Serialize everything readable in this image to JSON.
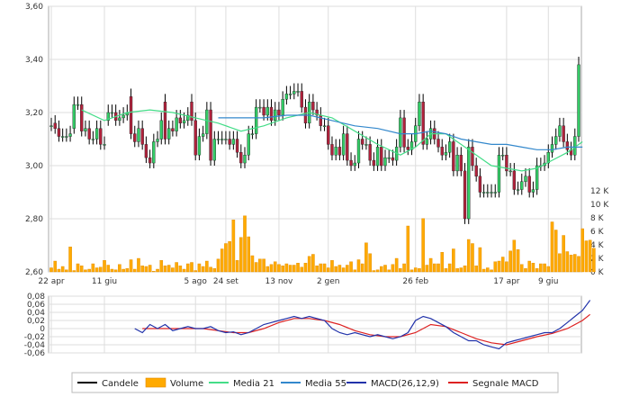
{
  "chart_data": {
    "type": "candlestick",
    "colors": {
      "up": "#33cc66",
      "down": "#b0213b",
      "wick": "#000000",
      "volume": "#ffaa00",
      "ma21": "#44dd88",
      "ma55": "#3388cc",
      "macd": "#2233aa",
      "signal": "#dd2222",
      "grid": "#dddddd"
    },
    "price_axis": {
      "ylim": [
        2.6,
        3.6
      ],
      "ticks": [
        {
          "v": 2.6,
          "label": "2,60"
        },
        {
          "v": 2.8,
          "label": "2,80"
        },
        {
          "v": 3.0,
          "label": "3,00"
        },
        {
          "v": 3.2,
          "label": "3,20"
        },
        {
          "v": 3.4,
          "label": "3,40"
        },
        {
          "v": 3.6,
          "label": "3,60"
        }
      ]
    },
    "volume_axis": {
      "ylim": [
        0,
        12000
      ],
      "ticks": [
        {
          "v": 0,
          "label": "0 K"
        },
        {
          "v": 2000,
          "label": "2 K"
        },
        {
          "v": 4000,
          "label": "4 K"
        },
        {
          "v": 6000,
          "label": "6 K"
        },
        {
          "v": 8000,
          "label": "8 K"
        },
        {
          "v": 10000,
          "label": "10 K"
        },
        {
          "v": 12000,
          "label": "12 K"
        }
      ]
    },
    "macd_axis": {
      "ylim": [
        -0.06,
        0.08
      ],
      "ticks": [
        {
          "v": -0.06,
          "label": "-0,06"
        },
        {
          "v": -0.04,
          "label": "-0,04"
        },
        {
          "v": -0.02,
          "label": "-0,02"
        },
        {
          "v": 0,
          "label": "0"
        },
        {
          "v": 0.02,
          "label": "0,02"
        },
        {
          "v": 0.04,
          "label": "0,04"
        },
        {
          "v": 0.06,
          "label": "0,06"
        },
        {
          "v": 0.08,
          "label": "0,08"
        }
      ]
    },
    "x_ticks": [
      {
        "i": 0,
        "label": "22 apr"
      },
      {
        "i": 14,
        "label": "11 giu"
      },
      {
        "i": 38,
        "label": "5 ago"
      },
      {
        "i": 46,
        "label": "24 set"
      },
      {
        "i": 60,
        "label": "13 nov"
      },
      {
        "i": 73,
        "label": "2 gen"
      },
      {
        "i": 96,
        "label": "26 feb"
      },
      {
        "i": 120,
        "label": "17 apr"
      },
      {
        "i": 131,
        "label": "9 giu"
      }
    ],
    "candles": {
      "close": [
        3.15,
        3.14,
        3.11,
        3.11,
        3.11,
        3.12,
        3.23,
        3.23,
        3.13,
        3.14,
        3.1,
        3.1,
        3.14,
        3.08,
        3.08,
        3.2,
        3.2,
        3.17,
        3.18,
        3.19,
        3.2,
        3.12,
        3.09,
        3.14,
        3.08,
        3.03,
        3.01,
        3.09,
        3.1,
        3.17,
        3.1,
        3.14,
        3.13,
        3.18,
        3.16,
        3.17,
        3.19,
        3.17,
        3.04,
        3.11,
        3.12,
        3.21,
        3.02,
        3.1,
        3.1,
        3.1,
        3.1,
        3.08,
        3.1,
        3.05,
        3.01,
        3.04,
        3.12,
        3.12,
        3.22,
        3.22,
        3.19,
        3.22,
        3.17,
        3.21,
        3.19,
        3.25,
        3.27,
        3.27,
        3.28,
        3.28,
        3.22,
        3.16,
        3.24,
        3.21,
        3.19,
        3.15,
        3.15,
        3.08,
        3.04,
        3.07,
        3.04,
        3.12,
        3.02,
        3.0,
        3.01,
        3.1,
        3.08,
        3.08,
        3.02,
        3.0,
        3.07,
        3.0,
        3.03,
        3.03,
        3.02,
        3.07,
        3.18,
        3.07,
        3.06,
        3.09,
        3.15,
        3.24,
        3.08,
        3.1,
        3.14,
        3.1,
        3.07,
        3.04,
        3.05,
        3.09,
        2.98,
        3.04,
        2.98,
        2.8,
        3.07,
        3.0,
        2.96,
        2.9,
        2.9,
        2.9,
        2.9,
        2.9,
        3.04,
        3.04,
        2.98,
        2.98,
        2.91,
        2.91,
        2.94,
        2.96,
        2.9,
        2.91,
        3.0,
        3.0,
        3.01,
        3.05,
        3.08,
        3.11,
        3.15,
        3.09,
        3.06,
        3.04,
        3.11,
        3.38
      ],
      "open": [
        3.15,
        3.16,
        3.14,
        3.11,
        3.11,
        3.11,
        3.14,
        3.23,
        3.23,
        3.13,
        3.14,
        3.1,
        3.1,
        3.14,
        3.08,
        3.17,
        3.2,
        3.2,
        3.17,
        3.18,
        3.19,
        3.26,
        3.12,
        3.09,
        3.14,
        3.08,
        3.03,
        3.01,
        3.09,
        3.1,
        3.24,
        3.1,
        3.14,
        3.13,
        3.18,
        3.16,
        3.17,
        3.24,
        3.17,
        3.04,
        3.11,
        3.12,
        3.21,
        3.02,
        3.1,
        3.1,
        3.1,
        3.1,
        3.08,
        3.1,
        3.05,
        3.01,
        3.04,
        3.12,
        3.12,
        3.22,
        3.22,
        3.19,
        3.22,
        3.17,
        3.21,
        3.19,
        3.25,
        3.27,
        3.27,
        3.28,
        3.28,
        3.22,
        3.16,
        3.24,
        3.21,
        3.19,
        3.15,
        3.15,
        3.08,
        3.04,
        3.07,
        3.04,
        3.12,
        3.02,
        3.0,
        3.01,
        3.1,
        3.08,
        3.08,
        3.02,
        3.0,
        3.07,
        3.0,
        3.03,
        3.03,
        3.02,
        3.07,
        3.18,
        3.07,
        3.06,
        3.09,
        3.15,
        3.24,
        3.08,
        3.1,
        3.14,
        3.1,
        3.07,
        3.04,
        3.05,
        3.09,
        2.98,
        3.04,
        2.98,
        2.8,
        3.07,
        3.0,
        2.96,
        2.9,
        2.9,
        2.9,
        2.9,
        2.9,
        3.04,
        3.04,
        2.98,
        2.98,
        2.91,
        2.91,
        2.94,
        2.96,
        2.9,
        2.91,
        3.0,
        3.0,
        3.01,
        3.05,
        3.08,
        3.11,
        3.15,
        3.09,
        3.06,
        3.04,
        3.11
      ],
      "volume": [
        600,
        1600,
        400,
        800,
        300,
        3700,
        200,
        1200,
        900,
        300,
        400,
        1200,
        600,
        700,
        1700,
        1000,
        400,
        300,
        1100,
        400,
        500,
        1800,
        400,
        2000,
        900,
        800,
        1000,
        100,
        400,
        1700,
        900,
        1000,
        600,
        1400,
        900,
        400,
        1200,
        1400,
        200,
        1200,
        800,
        1600,
        700,
        500,
        1900,
        3400,
        4200,
        4500,
        7700,
        1700,
        5100,
        8300,
        5200,
        2400,
        1400,
        1900,
        1900,
        800,
        1100,
        1500,
        1100,
        900,
        1200,
        1000,
        1000,
        1300,
        700,
        1300,
        2300,
        2600,
        900,
        1200,
        1200,
        600,
        1700,
        800,
        1000,
        600,
        1000,
        1500,
        300,
        1800,
        1200,
        4300,
        2700,
        200,
        300,
        800,
        1000,
        300,
        1100,
        2000,
        500,
        1200,
        6800,
        300,
        600,
        500,
        7900,
        1000,
        2000,
        1200,
        1200,
        2900,
        500,
        1200,
        3400,
        500,
        600,
        900,
        4800,
        4200,
        900,
        3600,
        400,
        600,
        300,
        1500,
        1600,
        2200,
        1500,
        3100,
        4700,
        3300,
        1100,
        500,
        1600,
        1300,
        500,
        1200,
        1200,
        800,
        7400,
        6200,
        2700,
        5400,
        3000,
        2500,
        2600,
        2300,
        6400,
        4600,
        4700,
        3500
      ]
    },
    "ma21": [
      [
        8,
        3.21
      ],
      [
        14,
        3.17
      ],
      [
        20,
        3.2
      ],
      [
        26,
        3.21
      ],
      [
        32,
        3.2
      ],
      [
        38,
        3.18
      ],
      [
        44,
        3.16
      ],
      [
        50,
        3.13
      ],
      [
        56,
        3.15
      ],
      [
        62,
        3.18
      ],
      [
        68,
        3.2
      ],
      [
        74,
        3.18
      ],
      [
        80,
        3.13
      ],
      [
        86,
        3.08
      ],
      [
        92,
        3.04
      ],
      [
        96,
        3.07
      ],
      [
        100,
        3.12
      ],
      [
        104,
        3.12
      ],
      [
        108,
        3.08
      ],
      [
        112,
        3.04
      ],
      [
        116,
        3.0
      ],
      [
        120,
        2.99
      ],
      [
        124,
        2.98
      ],
      [
        128,
        2.99
      ],
      [
        132,
        3.02
      ],
      [
        136,
        3.05
      ],
      [
        140,
        3.09
      ]
    ],
    "ma55": [
      [
        44,
        3.18
      ],
      [
        50,
        3.18
      ],
      [
        56,
        3.18
      ],
      [
        62,
        3.19
      ],
      [
        68,
        3.19
      ],
      [
        74,
        3.17
      ],
      [
        80,
        3.15
      ],
      [
        86,
        3.14
      ],
      [
        92,
        3.12
      ],
      [
        96,
        3.12
      ],
      [
        100,
        3.13
      ],
      [
        104,
        3.12
      ],
      [
        108,
        3.1
      ],
      [
        112,
        3.09
      ],
      [
        116,
        3.08
      ],
      [
        120,
        3.08
      ],
      [
        124,
        3.07
      ],
      [
        128,
        3.06
      ],
      [
        132,
        3.06
      ],
      [
        136,
        3.07
      ],
      [
        140,
        3.07
      ]
    ],
    "macd": [
      [
        22,
        0.0
      ],
      [
        24,
        -0.01
      ],
      [
        26,
        0.01
      ],
      [
        28,
        0.0
      ],
      [
        30,
        0.01
      ],
      [
        32,
        -0.005
      ],
      [
        34,
        0.0
      ],
      [
        36,
        0.005
      ],
      [
        38,
        0.0
      ],
      [
        40,
        0.0
      ],
      [
        42,
        0.005
      ],
      [
        44,
        -0.005
      ],
      [
        46,
        -0.01
      ],
      [
        48,
        -0.008
      ],
      [
        50,
        -0.015
      ],
      [
        52,
        -0.01
      ],
      [
        54,
        0.0
      ],
      [
        56,
        0.01
      ],
      [
        58,
        0.015
      ],
      [
        60,
        0.02
      ],
      [
        62,
        0.025
      ],
      [
        64,
        0.03
      ],
      [
        66,
        0.025
      ],
      [
        68,
        0.03
      ],
      [
        70,
        0.025
      ],
      [
        72,
        0.02
      ],
      [
        74,
        0.0
      ],
      [
        76,
        -0.01
      ],
      [
        78,
        -0.015
      ],
      [
        80,
        -0.01
      ],
      [
        82,
        -0.015
      ],
      [
        84,
        -0.02
      ],
      [
        86,
        -0.015
      ],
      [
        88,
        -0.02
      ],
      [
        90,
        -0.025
      ],
      [
        92,
        -0.02
      ],
      [
        94,
        -0.01
      ],
      [
        96,
        0.02
      ],
      [
        98,
        0.03
      ],
      [
        100,
        0.025
      ],
      [
        102,
        0.015
      ],
      [
        104,
        0.005
      ],
      [
        106,
        -0.01
      ],
      [
        108,
        -0.02
      ],
      [
        110,
        -0.03
      ],
      [
        112,
        -0.03
      ],
      [
        114,
        -0.04
      ],
      [
        116,
        -0.045
      ],
      [
        118,
        -0.05
      ],
      [
        120,
        -0.035
      ],
      [
        122,
        -0.03
      ],
      [
        124,
        -0.025
      ],
      [
        126,
        -0.02
      ],
      [
        128,
        -0.015
      ],
      [
        130,
        -0.01
      ],
      [
        132,
        -0.01
      ],
      [
        134,
        0.0
      ],
      [
        136,
        0.015
      ],
      [
        138,
        0.03
      ],
      [
        140,
        0.045
      ],
      [
        142,
        0.07
      ]
    ],
    "signal": [
      [
        24,
        0.0
      ],
      [
        28,
        0.0
      ],
      [
        32,
        0.0
      ],
      [
        36,
        0.0
      ],
      [
        40,
        0.0
      ],
      [
        44,
        -0.005
      ],
      [
        48,
        -0.01
      ],
      [
        52,
        -0.01
      ],
      [
        56,
        0.0
      ],
      [
        60,
        0.015
      ],
      [
        64,
        0.025
      ],
      [
        68,
        0.025
      ],
      [
        72,
        0.02
      ],
      [
        76,
        0.01
      ],
      [
        80,
        -0.005
      ],
      [
        84,
        -0.015
      ],
      [
        88,
        -0.02
      ],
      [
        92,
        -0.02
      ],
      [
        96,
        -0.01
      ],
      [
        100,
        0.01
      ],
      [
        104,
        0.005
      ],
      [
        108,
        -0.01
      ],
      [
        112,
        -0.025
      ],
      [
        116,
        -0.035
      ],
      [
        120,
        -0.04
      ],
      [
        124,
        -0.03
      ],
      [
        128,
        -0.02
      ],
      [
        132,
        -0.012
      ],
      [
        136,
        0.0
      ],
      [
        140,
        0.02
      ],
      [
        142,
        0.035
      ]
    ],
    "legend": [
      {
        "key": "wick",
        "label": "Candele"
      },
      {
        "key": "volume",
        "label": "Volume"
      },
      {
        "key": "ma21",
        "label": "Media 21"
      },
      {
        "key": "ma55",
        "label": "Media 55"
      },
      {
        "key": "macd",
        "label": "MACD(26,12,9)"
      },
      {
        "key": "signal",
        "label": "Segnale MACD"
      }
    ]
  }
}
